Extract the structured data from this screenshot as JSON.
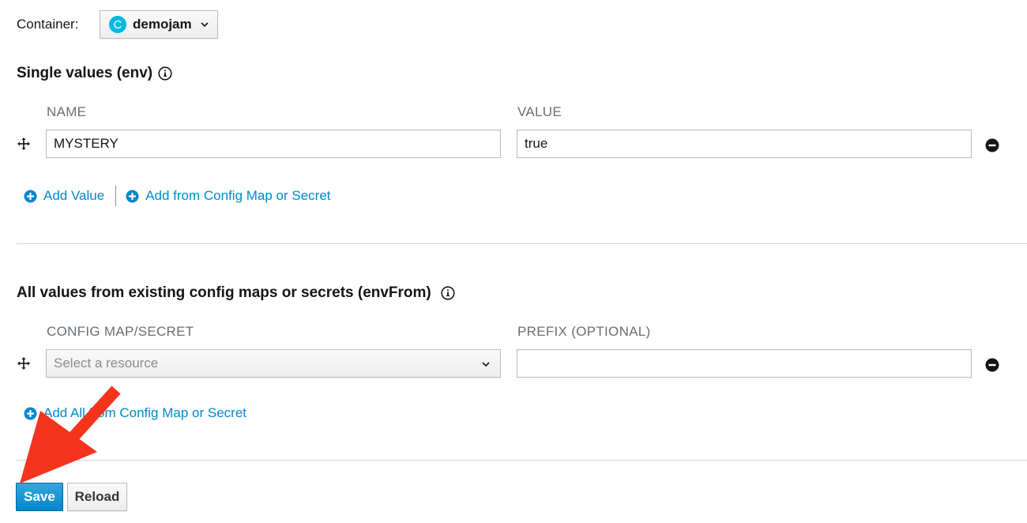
{
  "container": {
    "label": "Container:",
    "badge": "C",
    "selected": "demojam",
    "badge_color": "#00b9e4"
  },
  "env_section": {
    "title": "Single values (env)",
    "name_header": "NAME",
    "value_header": "VALUE",
    "rows": [
      {
        "name": "MYSTERY",
        "value": "true"
      }
    ],
    "add_value_label": "Add Value",
    "add_from_label": "Add from Config Map or Secret"
  },
  "envfrom_section": {
    "title": "All values from existing config maps or secrets (envFrom)",
    "resource_header": "CONFIG MAP/SECRET",
    "prefix_header": "PREFIX (OPTIONAL)",
    "rows": [
      {
        "resource_placeholder": "Select a resource",
        "prefix": ""
      }
    ],
    "add_all_label": "Add All from Config Map or Secret"
  },
  "actions": {
    "save_label": "Save",
    "reload_label": "Reload"
  },
  "colors": {
    "link": "#0088ce",
    "primary": "#0088ce",
    "annotation_arrow": "#f4341d"
  }
}
